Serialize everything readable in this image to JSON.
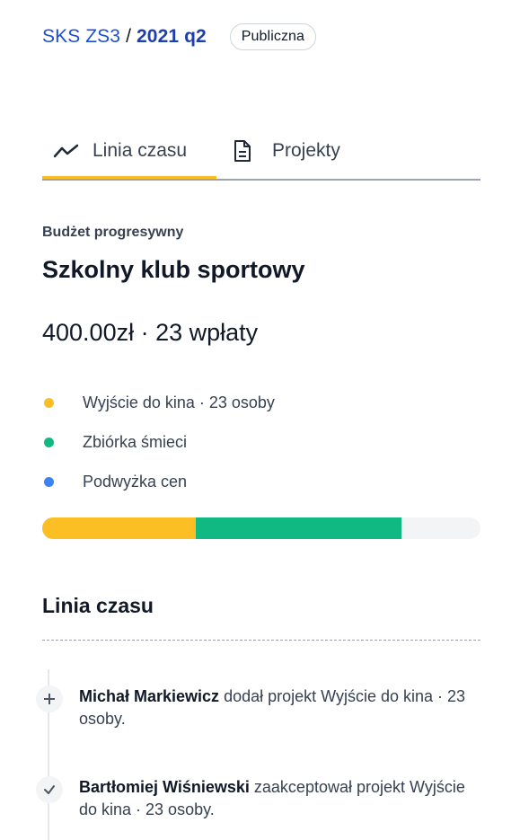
{
  "breadcrumb": {
    "parent": "SKS ZS3",
    "separator": "/",
    "current": "2021 q2",
    "badge": "Publiczna"
  },
  "tabs": [
    {
      "label": "Linia czasu",
      "icon": "trend-line-icon",
      "active": true
    },
    {
      "label": "Projekty",
      "icon": "document-icon",
      "active": false
    }
  ],
  "budget": {
    "type": "Budżet progresywny",
    "title": "Szkolny klub sportowy",
    "amount_line": "400.00zł · 23 wpłaty",
    "legend": [
      {
        "label": "Wyjście do kina · 23 osoby",
        "color": "#fbbf24"
      },
      {
        "label": "Zbiórka śmieci",
        "color": "#10b981"
      },
      {
        "label": "Podwyżka cen",
        "color": "#3b82f6"
      }
    ],
    "progress_fractions": [
      0.35,
      0.47
    ],
    "progress_colors": [
      "#fbbf24",
      "#10b981"
    ]
  },
  "timeline": {
    "heading": "Linia czasu",
    "entries": [
      {
        "icon": "plus-icon",
        "actor": "Michał Markiewicz",
        "text": " dodał projekt Wyjście do kina · 23 osoby."
      },
      {
        "icon": "check-icon",
        "actor": "Bartłomiej Wiśniewski",
        "text": " zaakceptował projekt Wyjście do kina · 23 osoby."
      }
    ]
  }
}
